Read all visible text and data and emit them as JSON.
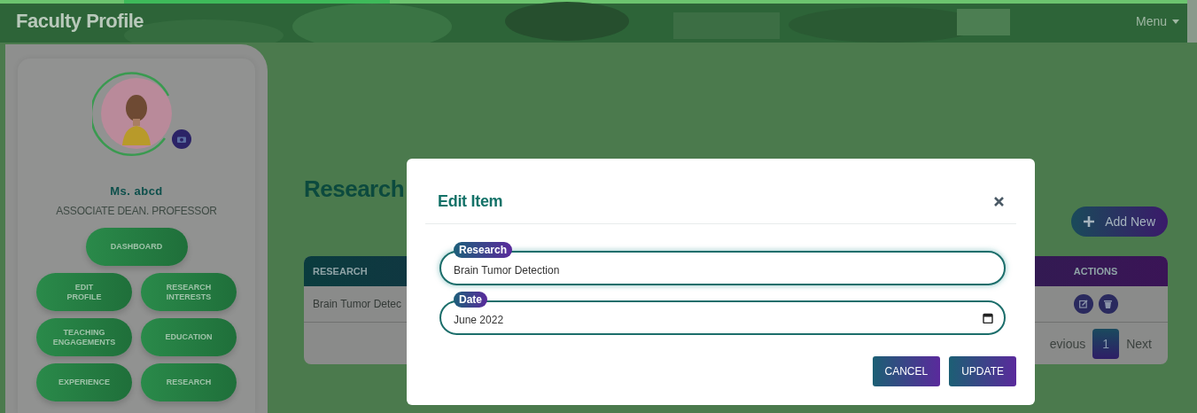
{
  "header": {
    "title": "Faculty Profile",
    "menu": "Menu"
  },
  "profile": {
    "name": "Ms. abcd",
    "role": "ASSOCIATE DEAN. PROFESSOR"
  },
  "nav": [
    {
      "label": "DASHBOARD"
    },
    {
      "label": "EDIT\nPROFILE"
    },
    {
      "label": "RESEARCH\nINTERESTS"
    },
    {
      "label": "TEACHING\nENGAGEMENTS"
    },
    {
      "label": "EDUCATION"
    },
    {
      "label": "EXPERIENCE"
    },
    {
      "label": "RESEARCH"
    }
  ],
  "section": {
    "title": "Research",
    "add_button": "Add New"
  },
  "table": {
    "columns": [
      "RESEARCH",
      "ACTIONS"
    ],
    "rows": [
      {
        "cells": [
          "Brain Tumor Detec"
        ]
      }
    ],
    "pagination": {
      "previous": "evious",
      "pages": [
        {
          "label": "1",
          "selected": true
        }
      ],
      "next": "Next"
    }
  },
  "modal": {
    "title": "Edit Item",
    "fields": [
      {
        "label": "Research",
        "value": "Brain Tumor Detection",
        "kind": "text",
        "focused": true
      },
      {
        "label": "Date",
        "value": "June 2022",
        "kind": "date",
        "focused": false
      }
    ],
    "buttons": [
      "CANCEL",
      "UPDATE"
    ]
  }
}
